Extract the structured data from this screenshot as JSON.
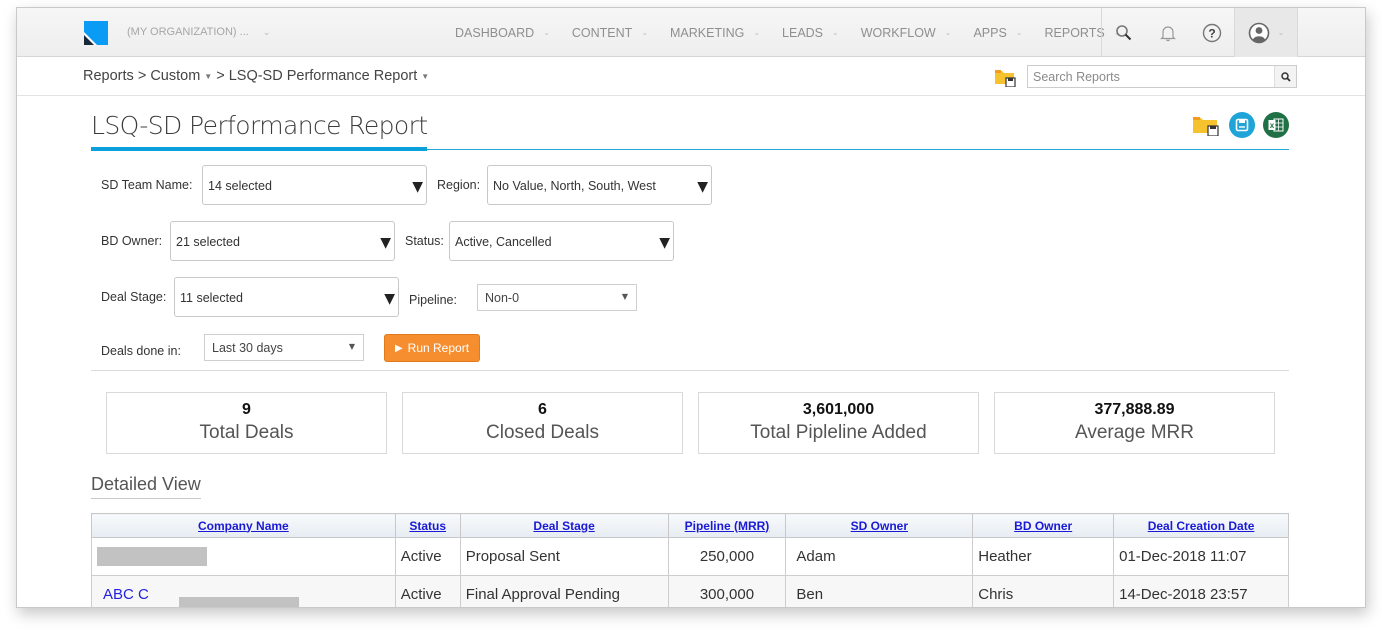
{
  "nav": {
    "org_name": "(MY ORGANIZATION) ...",
    "menu": [
      {
        "label": "DASHBOARD"
      },
      {
        "label": "CONTENT"
      },
      {
        "label": "MARKETING"
      },
      {
        "label": "LEADS"
      },
      {
        "label": "WORKFLOW"
      },
      {
        "label": "APPS"
      },
      {
        "label": "REPORTS"
      }
    ],
    "icons": [
      "search-icon",
      "bell-icon",
      "help-icon",
      "user-icon"
    ]
  },
  "breadcrumb": {
    "root": "Reports",
    "sep": ">",
    "level1": "Custom",
    "level2": "LSQ-SD Performance Report"
  },
  "search": {
    "placeholder": "Search Reports",
    "value": ""
  },
  "report": {
    "title": "LSQ-SD Performance Report",
    "actions": [
      "save-folder-icon",
      "save-icon",
      "excel-export-icon"
    ]
  },
  "filters": {
    "sd_team": {
      "label": "SD Team Name:",
      "value": "14 selected"
    },
    "region": {
      "label": "Region:",
      "value": "No Value, North, South, West"
    },
    "bd_owner": {
      "label": "BD Owner:",
      "value": "21 selected"
    },
    "status": {
      "label": "Status:",
      "value": "Active, Cancelled"
    },
    "deal_stage": {
      "label": "Deal Stage:",
      "value": "11 selected"
    },
    "pipeline": {
      "label": "Pipeline:",
      "value": "Non-0"
    },
    "deals_done_in": {
      "label": "Deals done in:",
      "value": "Last 30 days"
    },
    "run_label": "Run Report"
  },
  "kpis": [
    {
      "value": "9",
      "label": "Total Deals"
    },
    {
      "value": "6",
      "label": "Closed Deals"
    },
    {
      "value": "3,601,000",
      "label": "Total Pipleline Added"
    },
    {
      "value": "377,888.89",
      "label": "Average MRR"
    }
  ],
  "detailed": {
    "title": "Detailed View",
    "columns": [
      "Company Name",
      "Status",
      "Deal Stage",
      "Pipeline (MRR)",
      "SD Owner",
      "BD Owner",
      "Deal Creation Date"
    ],
    "rows": [
      {
        "company": "",
        "status": "Active",
        "stage": "Proposal Sent",
        "pipeline": "250,000",
        "sd_owner": "Adam",
        "bd_owner": "Heather",
        "date": "01-Dec-2018 11:07"
      },
      {
        "company": "ABC C",
        "status": "Active",
        "stage": "Final Approval Pending",
        "pipeline": "300,000",
        "sd_owner": "Ben",
        "bd_owner": "Chris",
        "date": "14-Dec-2018 23:57"
      }
    ]
  }
}
